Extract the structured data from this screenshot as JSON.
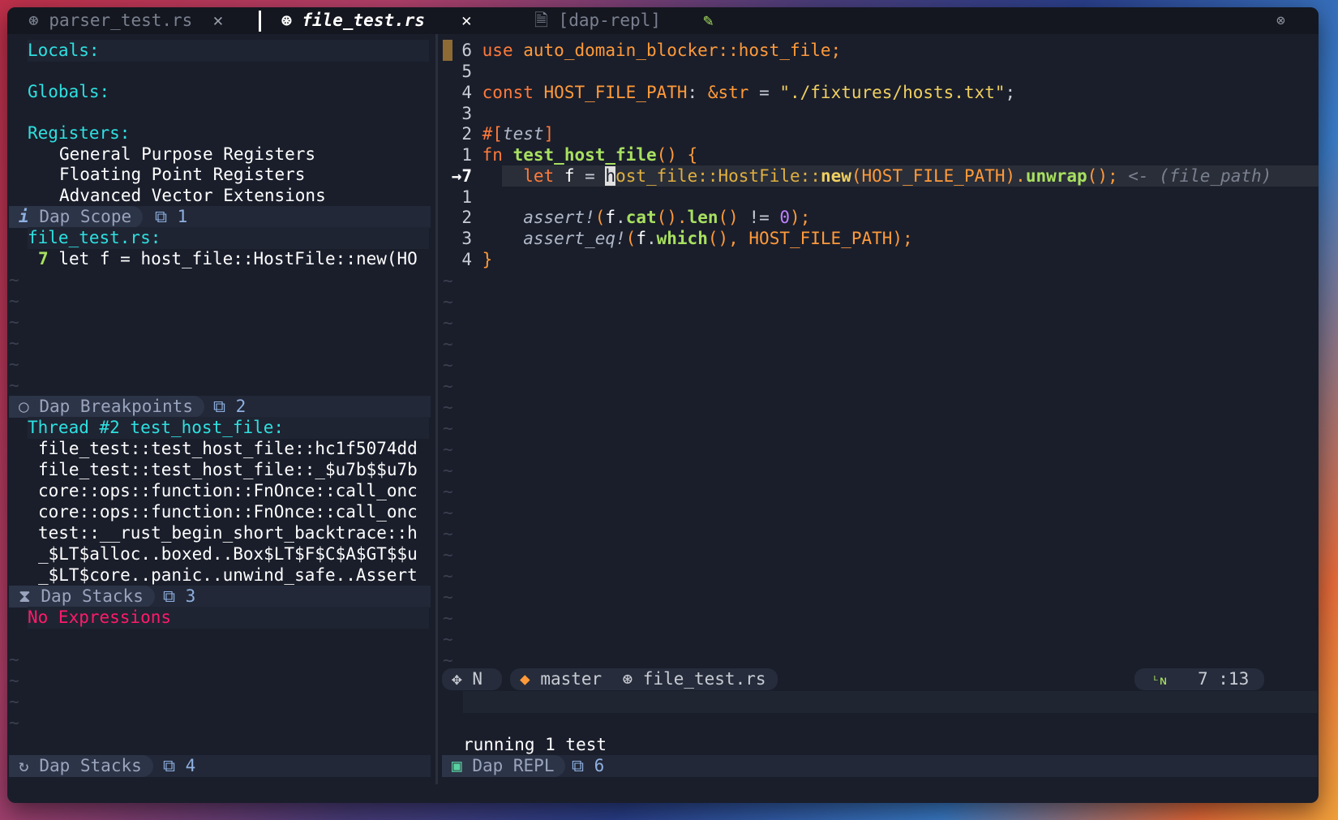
{
  "tabs": [
    {
      "icon": "⊛",
      "label": "parser_test.rs",
      "close": "✕"
    },
    {
      "icon": "⊛",
      "label": "file_test.rs",
      "close": "✕"
    },
    {
      "icon": "🗎",
      "label": "[dap-repl]",
      "edit": "✎"
    }
  ],
  "window_close": "⊗",
  "scopes": {
    "locals": "Locals:",
    "globals": "Globals:",
    "registers": "Registers:",
    "register_items": [
      "General Purpose Registers",
      "Floating Point Registers",
      "Advanced Vector Extensions"
    ]
  },
  "scope_header": {
    "icon": "i",
    "title": "Dap Scope",
    "link": "⧉",
    "num": "1"
  },
  "breakpoints": {
    "file": "file_test.rs:",
    "line_no": "7",
    "line": "let f = host_file::HostFile::new(HO"
  },
  "breakpoints_header": {
    "icon": "○",
    "title": "Dap Breakpoints",
    "link": "⧉",
    "num": "2"
  },
  "stack": {
    "thread": "Thread #2 test_host_file:",
    "frames": [
      "file_test::test_host_file::hc1f5074dd",
      "file_test::test_host_file::_$u7b$$u7b",
      "core::ops::function::FnOnce::call_onc",
      "core::ops::function::FnOnce::call_onc",
      "test::__rust_begin_short_backtrace::h",
      "_$LT$alloc..boxed..Box$LT$F$C$A$GT$$u",
      "_$LT$core..panic..unwind_safe..Assert"
    ]
  },
  "stacks_header": {
    "icon": "⧗",
    "title": "Dap Stacks",
    "link": "⧉",
    "num": "3"
  },
  "watches": {
    "empty": "No Expressions"
  },
  "bottom_left_header": {
    "icon": "↻",
    "title": "Dap Stacks",
    "link": "⧉",
    "num": "4"
  },
  "code": {
    "lines": [
      {
        "n": "6",
        "t": "use auto_domain_blocker::host_file;"
      },
      {
        "n": "5",
        "t": ""
      },
      {
        "n": "4",
        "t": "const HOST_FILE_PATH: &str = \"./fixtures/hosts.txt\";"
      },
      {
        "n": "3",
        "t": ""
      },
      {
        "n": "2",
        "t": "#[test]"
      },
      {
        "n": "1",
        "t": "fn test_host_file() {"
      },
      {
        "n": "7",
        "t": "let f = host_file::HostFile::new(HOST_FILE_PATH).unwrap();",
        "virtual": "<- (file_path)",
        "arrow": "→"
      },
      {
        "n": "1",
        "t": ""
      },
      {
        "n": "2",
        "t": "assert!(f.cat().len() != 0);"
      },
      {
        "n": "3",
        "t": "assert_eq!(f.which(), HOST_FILE_PATH);"
      },
      {
        "n": "4",
        "t": "}"
      }
    ]
  },
  "statusline": {
    "mode_icon": "✥",
    "mode": "N",
    "branch_icon": "◆",
    "branch": "master",
    "file_icon": "⊛",
    "file": "file_test.rs",
    "pos_icon": "ᴸɴ",
    "position": "7 :13"
  },
  "repl": {
    "output": "running 1 test"
  },
  "repl_header": {
    "icon": "▣",
    "title": "Dap REPL",
    "link": "⧉",
    "num": "6"
  },
  "colors": {
    "bg": "#1a1e2b",
    "cyan": "#2ee0e0",
    "keyword": "#ff7a3a",
    "function": "#a8e060",
    "error": "#ff1a6a"
  }
}
